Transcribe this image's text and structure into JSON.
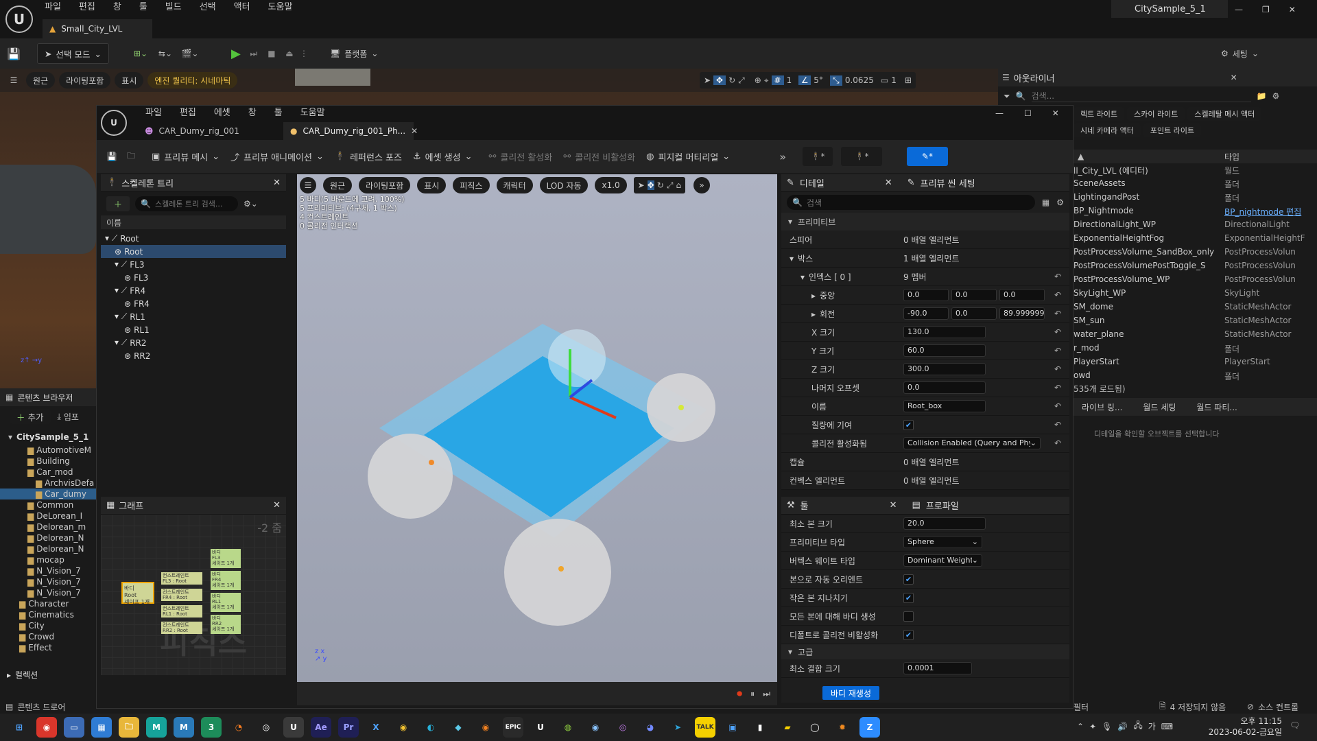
{
  "main": {
    "menu": [
      "파일",
      "편집",
      "창",
      "툴",
      "빌드",
      "선택",
      "액터",
      "도움말"
    ],
    "level_tab": "Small_City_LVL",
    "project_title": "CitySample_5_1",
    "select_mode": "선택 모드",
    "platforms": "플랫폼",
    "settings": "세팅",
    "vp_buttons": [
      "원근",
      "라이팅포함",
      "표시"
    ],
    "engine_quality": "엔진 퀄리티: 시네마틱",
    "snap_angle": "5°",
    "snap_scale": "0.0625",
    "camera_speed": "1",
    "grid_value": "1"
  },
  "outliner": {
    "title": "아웃라이너",
    "search_placeholder": "검색...",
    "quick_buttons": [
      "렉트 라이트",
      "스카이 라이트",
      "스켈레탈 메시 액터",
      "시네 카메라 액터",
      "포인트 라이트"
    ],
    "type_header": "타입",
    "rows": [
      {
        "name": "ll_City_LVL (에디터)",
        "type": "월드"
      },
      {
        "name": "SceneAssets",
        "type": "폴더"
      },
      {
        "name": "LightingandPost",
        "type": "폴더"
      },
      {
        "name": "BP_Nightmode",
        "type": "BP_nightmode 편집"
      },
      {
        "name": "DirectionalLight_WP",
        "type": "DirectionalLight"
      },
      {
        "name": "ExponentialHeightFog",
        "type": "ExponentialHeightF"
      },
      {
        "name": "PostProcessVolume_SandBox_only",
        "type": "PostProcessVolun"
      },
      {
        "name": "PostProcessVolumePostToggle_S",
        "type": "PostProcessVolun"
      },
      {
        "name": "PostProcessVolume_WP",
        "type": "PostProcessVolun"
      },
      {
        "name": "SkyLight_WP",
        "type": "SkyLight"
      },
      {
        "name": "SM_dome",
        "type": "StaticMeshActor"
      },
      {
        "name": "SM_sun",
        "type": "StaticMeshActor"
      },
      {
        "name": "water_plane",
        "type": "StaticMeshActor"
      },
      {
        "name": "r_mod",
        "type": "폴더"
      },
      {
        "name": "PlayerStart",
        "type": "PlayerStart"
      },
      {
        "name": "owd",
        "type": "폴더"
      }
    ],
    "count": "535개 로드됨)",
    "tabs": [
      "라이브 링...",
      "월드 세팅",
      "월드 파티..."
    ],
    "empty_hint": "디테일을 확인할 오브젝트를 선택합니다"
  },
  "content_browser": {
    "title": "콘텐츠 브라우저",
    "add": "추가",
    "import": "임포",
    "root": "CitySample_5_1",
    "folders": [
      "AutomotiveM",
      "Building",
      "Car_mod",
      "ArchvisDefa",
      "Car_dumy",
      "Common",
      "DeLorean_I",
      "Delorean_m",
      "Delorean_N",
      "Delorean_N",
      "mocap",
      "N_Vision_7",
      "N_Vision_7",
      "N_Vision_7",
      "Character",
      "Cinematics",
      "City",
      "Crowd",
      "Effect"
    ],
    "collections": "컬렉션",
    "drawer": "콘텐츠 드로어"
  },
  "pa": {
    "menu": [
      "파일",
      "편집",
      "에셋",
      "창",
      "툴",
      "도움말"
    ],
    "tabs": [
      "CAR_Dumy_rig_001",
      "CAR_Dumy_rig_001_Ph..."
    ],
    "toolbar": [
      "프리뷰 메시",
      "프리뷰 애니메이션",
      "레퍼런스 포즈",
      "에셋 생성",
      "콜리전 활성화",
      "콜리전 비활성화",
      "피지컬 머티리얼"
    ],
    "skeleton_tree": {
      "title": "스켈레톤 트리",
      "search_placeholder": "스켈레톤 트리 검색...",
      "name_header": "이름",
      "rows": [
        {
          "label": "Root",
          "kind": "bone",
          "indent": 0
        },
        {
          "label": "Root",
          "kind": "body",
          "indent": 1
        },
        {
          "label": "FL3",
          "kind": "bone",
          "indent": 1
        },
        {
          "label": "FL3",
          "kind": "body",
          "indent": 2
        },
        {
          "label": "FR4",
          "kind": "bone",
          "indent": 1
        },
        {
          "label": "FR4",
          "kind": "body",
          "indent": 2
        },
        {
          "label": "RL1",
          "kind": "bone",
          "indent": 1
        },
        {
          "label": "RL1",
          "kind": "body",
          "indent": 2
        },
        {
          "label": "RR2",
          "kind": "bone",
          "indent": 1
        },
        {
          "label": "RR2",
          "kind": "body",
          "indent": 2
        }
      ]
    },
    "graph": {
      "title": "그래프",
      "zoom": "-2 줌",
      "watermark": "피직스",
      "root_node": [
        "바디",
        "Root",
        "셰이프 1개"
      ],
      "constraints": [
        [
          "컨스트레인트",
          "FL3 : Root"
        ],
        [
          "컨스트레인트",
          "FR4 : Root"
        ],
        [
          "컨스트레인트",
          "RL1 : Root"
        ],
        [
          "컨스트레인트",
          "RR2 : Root"
        ]
      ],
      "bodies": [
        [
          "바디",
          "FL3",
          "셰이프 1개"
        ],
        [
          "바디",
          "FR4",
          "셰이프 1개"
        ],
        [
          "바디",
          "RL1",
          "셰이프 1개"
        ],
        [
          "바디",
          "RR2",
          "셰이프 1개"
        ]
      ]
    },
    "viewport": {
      "buttons": [
        "원근",
        "라이팅포함",
        "표시",
        "피직스",
        "캐릭터",
        "LOD 자동",
        "x1.0"
      ],
      "stats": [
        "5 바디(5 바운드에 고려, 100%)",
        "5 프리미티브: (4구체, 1 박스)",
        "4 컨스트레인트",
        "0 콜리전 인터랙션"
      ]
    },
    "details": {
      "title": "디테일",
      "preview_tab": "프리뷰 씬 세팅",
      "search_placeholder": "검색",
      "section": "프리미티브",
      "rows": [
        {
          "label": "스피어",
          "value": "0 배열 엘리먼트",
          "level": 1
        },
        {
          "label": "박스",
          "value": "1 배열 엘리먼트",
          "level": 1,
          "expanded": true
        },
        {
          "label": "인덱스 [ 0 ]",
          "value": "9 멤버",
          "level": 2,
          "expanded": true
        },
        {
          "label": "중앙",
          "vec": [
            "0.0",
            "0.0",
            "0.0"
          ],
          "level": 3
        },
        {
          "label": "회전",
          "vec": [
            "-90.0",
            "0.0",
            "89.999999"
          ],
          "level": 3
        },
        {
          "label": "X 크기",
          "num": "130.0",
          "level": 3
        },
        {
          "label": "Y 크기",
          "num": "60.0",
          "level": 3
        },
        {
          "label": "Z 크기",
          "num": "300.0",
          "level": 3
        },
        {
          "label": "나머지 오프셋",
          "num": "0.0",
          "level": 3
        },
        {
          "label": "이름",
          "num": "Root_box",
          "level": 3
        },
        {
          "label": "질량에 기여",
          "check": true,
          "level": 3
        },
        {
          "label": "콜리전 활성화됨",
          "select": "Collision Enabled (Query and Phys",
          "level": 3
        },
        {
          "label": "캡슐",
          "value": "0 배열 엘리먼트",
          "level": 1
        },
        {
          "label": "컨벡스 엘리먼트",
          "value": "0 배열 엘리먼트",
          "level": 1
        }
      ]
    },
    "tools": {
      "title": "툴",
      "profile_tab": "프로파일",
      "rows": [
        {
          "label": "최소 본 크기",
          "num": "20.0"
        },
        {
          "label": "프리미티브 타입",
          "select": "Sphere"
        },
        {
          "label": "버텍스 웨이트 타입",
          "select": "Dominant Weight"
        },
        {
          "label": "본으로 자동 오리엔트",
          "check": true
        },
        {
          "label": "작은 본 지나치기",
          "check": true
        },
        {
          "label": "모든 본에 대해 바디 생성",
          "check": false
        },
        {
          "label": "디폴트로 콜리전 비활성화",
          "check": true
        }
      ],
      "advanced": "고급",
      "min_weld": {
        "label": "최소 결합 크기",
        "num": "0.0001"
      },
      "regen_button": "바디 재생성"
    }
  },
  "statusbar": {
    "unsaved": "4 저장되지 않음",
    "source_control": "소스 컨트롤",
    "filter": "필터"
  },
  "taskbar": {
    "time": "오후 11:15",
    "date": "2023-06-02-금요일"
  }
}
